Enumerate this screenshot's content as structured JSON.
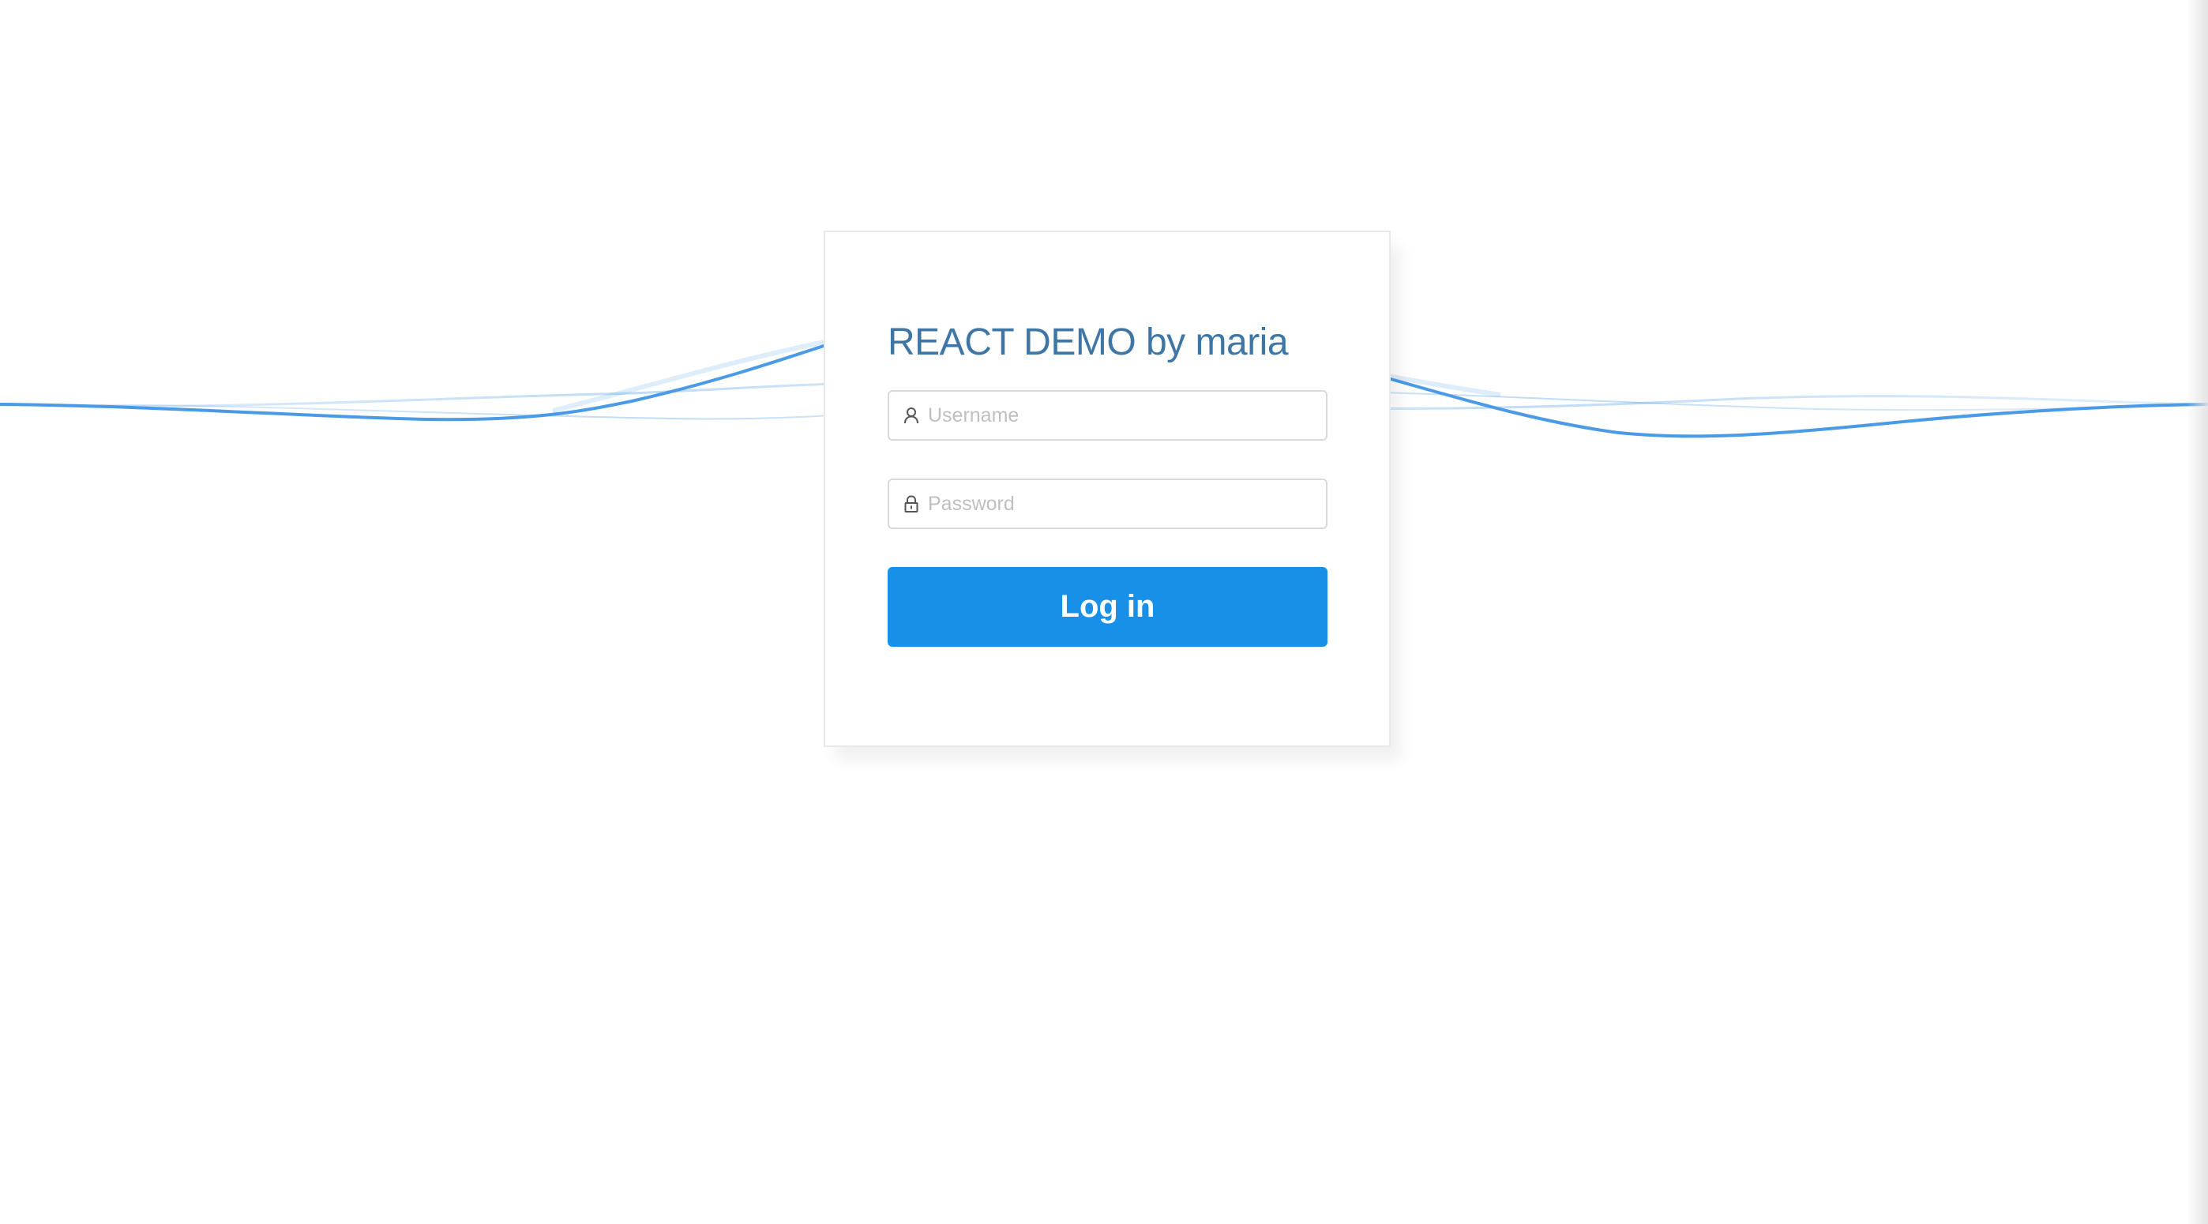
{
  "login": {
    "title": "REACT DEMO by maria",
    "username": {
      "placeholder": "Username",
      "value": "",
      "icon": "user-icon"
    },
    "password": {
      "placeholder": "Password",
      "value": "",
      "icon": "lock-icon"
    },
    "submit_label": "Log in"
  },
  "colors": {
    "accent": "#1890e8",
    "title": "#3e76a6",
    "wave": "#4a9ae6",
    "border": "#d9d9d9"
  }
}
